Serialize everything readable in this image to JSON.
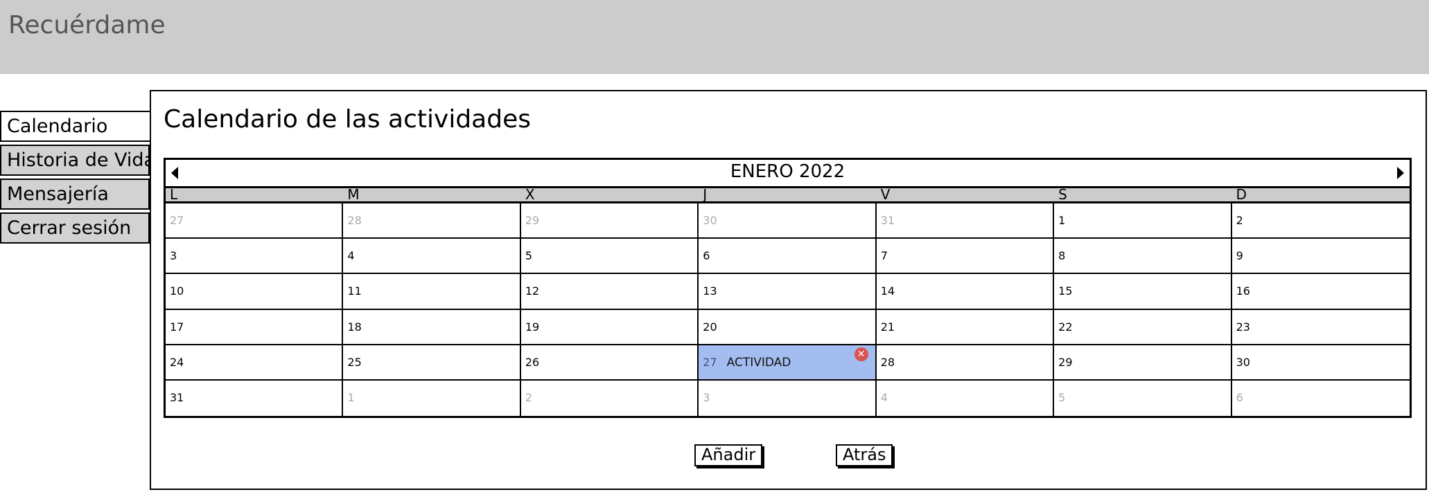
{
  "app": {
    "title": "Recuérdame"
  },
  "nav": {
    "items": [
      {
        "label": "Calendario"
      },
      {
        "label": "Historia de Vida"
      },
      {
        "label": "Mensajería"
      },
      {
        "label": "Cerrar sesión"
      }
    ]
  },
  "main": {
    "title": "Calendario de las actividades",
    "calendar": {
      "month_label": "ENERO 2022",
      "weekdays": [
        "L",
        "M",
        "X",
        "J",
        "V",
        "S",
        "D"
      ],
      "days": [
        "27",
        "28",
        "29",
        "30",
        "31",
        "1",
        "2",
        "3",
        "4",
        "5",
        "6",
        "7",
        "8",
        "9",
        "10",
        "11",
        "12",
        "13",
        "14",
        "15",
        "16",
        "17",
        "18",
        "19",
        "20",
        "21",
        "22",
        "23",
        "24",
        "25",
        "26",
        "27",
        "28",
        "29",
        "30",
        "31",
        "1",
        "2",
        "3",
        "4",
        "5",
        "6"
      ],
      "event": {
        "label": "ACTIVIDAD",
        "remove_icon": "x-circle-icon"
      }
    },
    "buttons": {
      "add": "Añadir",
      "back": "Atrás"
    }
  },
  "colors": {
    "header_bg": "#cccccc",
    "event_bg": "#a4bdf0",
    "remove_icon": "#d9534f",
    "muted_day": "#aaaaaa"
  }
}
